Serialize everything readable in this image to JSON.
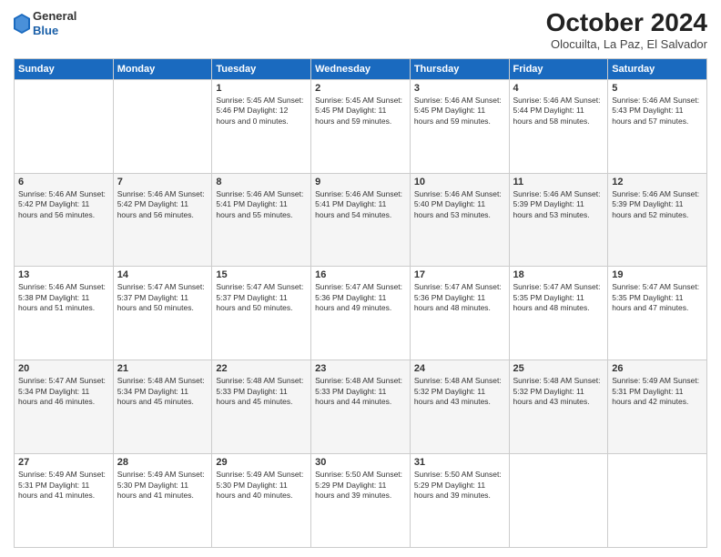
{
  "header": {
    "logo_general": "General",
    "logo_blue": "Blue",
    "month_title": "October 2024",
    "location": "Olocuilta, La Paz, El Salvador"
  },
  "days_of_week": [
    "Sunday",
    "Monday",
    "Tuesday",
    "Wednesday",
    "Thursday",
    "Friday",
    "Saturday"
  ],
  "weeks": [
    [
      {
        "num": "",
        "detail": ""
      },
      {
        "num": "",
        "detail": ""
      },
      {
        "num": "1",
        "detail": "Sunrise: 5:45 AM\nSunset: 5:46 PM\nDaylight: 12 hours\nand 0 minutes."
      },
      {
        "num": "2",
        "detail": "Sunrise: 5:45 AM\nSunset: 5:45 PM\nDaylight: 11 hours\nand 59 minutes."
      },
      {
        "num": "3",
        "detail": "Sunrise: 5:46 AM\nSunset: 5:45 PM\nDaylight: 11 hours\nand 59 minutes."
      },
      {
        "num": "4",
        "detail": "Sunrise: 5:46 AM\nSunset: 5:44 PM\nDaylight: 11 hours\nand 58 minutes."
      },
      {
        "num": "5",
        "detail": "Sunrise: 5:46 AM\nSunset: 5:43 PM\nDaylight: 11 hours\nand 57 minutes."
      }
    ],
    [
      {
        "num": "6",
        "detail": "Sunrise: 5:46 AM\nSunset: 5:42 PM\nDaylight: 11 hours\nand 56 minutes."
      },
      {
        "num": "7",
        "detail": "Sunrise: 5:46 AM\nSunset: 5:42 PM\nDaylight: 11 hours\nand 56 minutes."
      },
      {
        "num": "8",
        "detail": "Sunrise: 5:46 AM\nSunset: 5:41 PM\nDaylight: 11 hours\nand 55 minutes."
      },
      {
        "num": "9",
        "detail": "Sunrise: 5:46 AM\nSunset: 5:41 PM\nDaylight: 11 hours\nand 54 minutes."
      },
      {
        "num": "10",
        "detail": "Sunrise: 5:46 AM\nSunset: 5:40 PM\nDaylight: 11 hours\nand 53 minutes."
      },
      {
        "num": "11",
        "detail": "Sunrise: 5:46 AM\nSunset: 5:39 PM\nDaylight: 11 hours\nand 53 minutes."
      },
      {
        "num": "12",
        "detail": "Sunrise: 5:46 AM\nSunset: 5:39 PM\nDaylight: 11 hours\nand 52 minutes."
      }
    ],
    [
      {
        "num": "13",
        "detail": "Sunrise: 5:46 AM\nSunset: 5:38 PM\nDaylight: 11 hours\nand 51 minutes."
      },
      {
        "num": "14",
        "detail": "Sunrise: 5:47 AM\nSunset: 5:37 PM\nDaylight: 11 hours\nand 50 minutes."
      },
      {
        "num": "15",
        "detail": "Sunrise: 5:47 AM\nSunset: 5:37 PM\nDaylight: 11 hours\nand 50 minutes."
      },
      {
        "num": "16",
        "detail": "Sunrise: 5:47 AM\nSunset: 5:36 PM\nDaylight: 11 hours\nand 49 minutes."
      },
      {
        "num": "17",
        "detail": "Sunrise: 5:47 AM\nSunset: 5:36 PM\nDaylight: 11 hours\nand 48 minutes."
      },
      {
        "num": "18",
        "detail": "Sunrise: 5:47 AM\nSunset: 5:35 PM\nDaylight: 11 hours\nand 48 minutes."
      },
      {
        "num": "19",
        "detail": "Sunrise: 5:47 AM\nSunset: 5:35 PM\nDaylight: 11 hours\nand 47 minutes."
      }
    ],
    [
      {
        "num": "20",
        "detail": "Sunrise: 5:47 AM\nSunset: 5:34 PM\nDaylight: 11 hours\nand 46 minutes."
      },
      {
        "num": "21",
        "detail": "Sunrise: 5:48 AM\nSunset: 5:34 PM\nDaylight: 11 hours\nand 45 minutes."
      },
      {
        "num": "22",
        "detail": "Sunrise: 5:48 AM\nSunset: 5:33 PM\nDaylight: 11 hours\nand 45 minutes."
      },
      {
        "num": "23",
        "detail": "Sunrise: 5:48 AM\nSunset: 5:33 PM\nDaylight: 11 hours\nand 44 minutes."
      },
      {
        "num": "24",
        "detail": "Sunrise: 5:48 AM\nSunset: 5:32 PM\nDaylight: 11 hours\nand 43 minutes."
      },
      {
        "num": "25",
        "detail": "Sunrise: 5:48 AM\nSunset: 5:32 PM\nDaylight: 11 hours\nand 43 minutes."
      },
      {
        "num": "26",
        "detail": "Sunrise: 5:49 AM\nSunset: 5:31 PM\nDaylight: 11 hours\nand 42 minutes."
      }
    ],
    [
      {
        "num": "27",
        "detail": "Sunrise: 5:49 AM\nSunset: 5:31 PM\nDaylight: 11 hours\nand 41 minutes."
      },
      {
        "num": "28",
        "detail": "Sunrise: 5:49 AM\nSunset: 5:30 PM\nDaylight: 11 hours\nand 41 minutes."
      },
      {
        "num": "29",
        "detail": "Sunrise: 5:49 AM\nSunset: 5:30 PM\nDaylight: 11 hours\nand 40 minutes."
      },
      {
        "num": "30",
        "detail": "Sunrise: 5:50 AM\nSunset: 5:29 PM\nDaylight: 11 hours\nand 39 minutes."
      },
      {
        "num": "31",
        "detail": "Sunrise: 5:50 AM\nSunset: 5:29 PM\nDaylight: 11 hours\nand 39 minutes."
      },
      {
        "num": "",
        "detail": ""
      },
      {
        "num": "",
        "detail": ""
      }
    ]
  ]
}
